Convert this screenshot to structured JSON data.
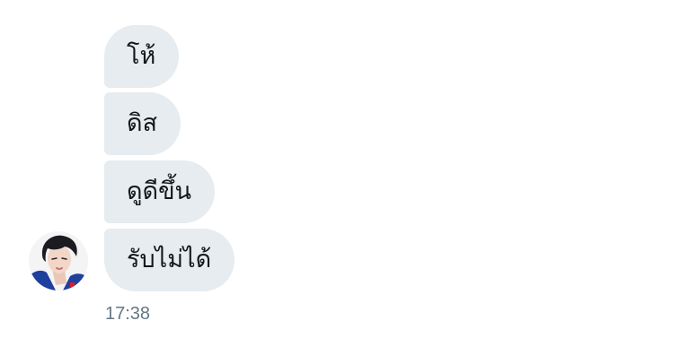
{
  "conversation": {
    "messages": [
      {
        "text": "โห้"
      },
      {
        "text": "ดิส"
      },
      {
        "text": "ดูดีขึ้น"
      },
      {
        "text": "รับไม่ได้"
      }
    ],
    "timestamp": "17:38",
    "sender_avatar": "profile-photo"
  },
  "colors": {
    "bubble_background": "#e6ecf0",
    "message_text": "#14171a",
    "timestamp_text": "#657786",
    "page_background": "#ffffff"
  }
}
